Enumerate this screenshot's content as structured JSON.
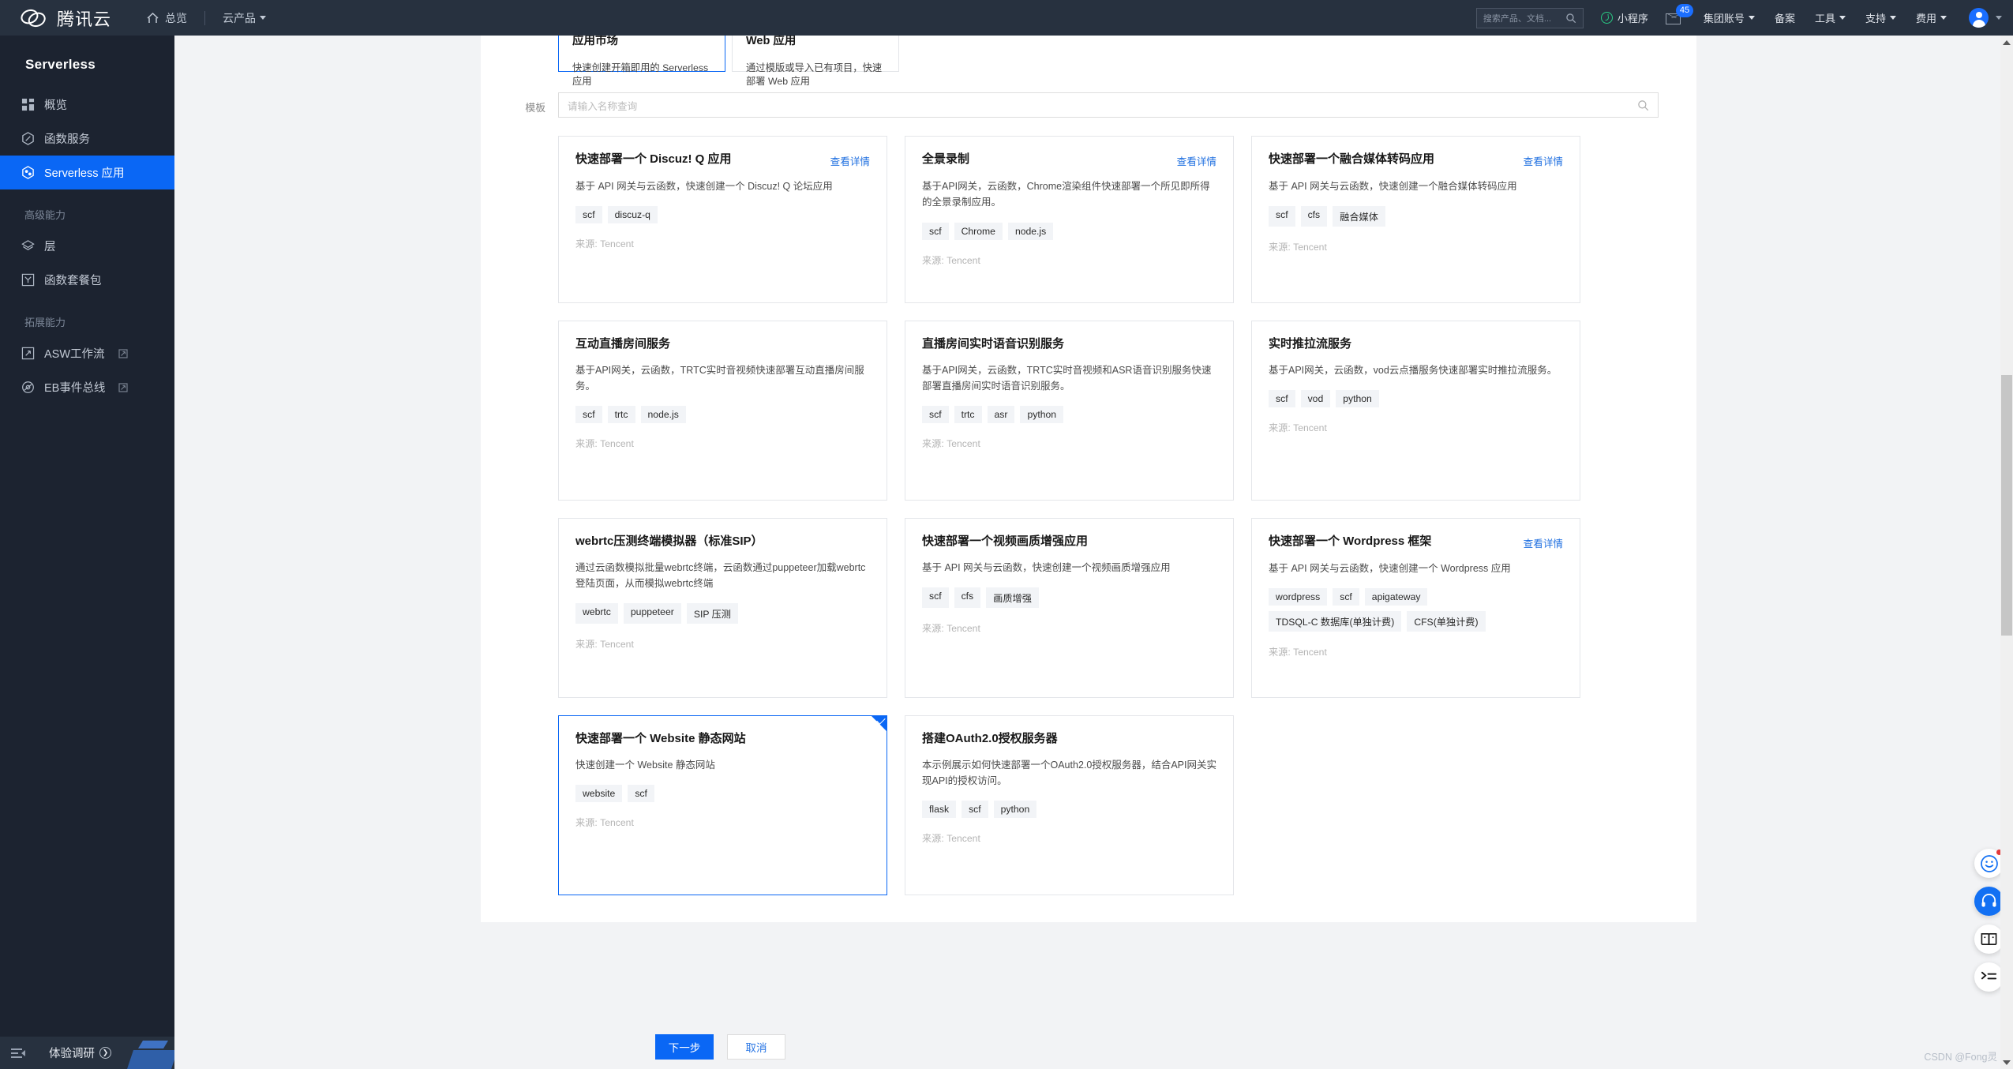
{
  "topbar": {
    "brand": "腾讯云",
    "home": "总览",
    "products": "云产品",
    "search_placeholder": "搜索产品、文档...",
    "mini_app": "小程序",
    "mail_badge": "45",
    "items": [
      {
        "label": "集团账号",
        "caret": true
      },
      {
        "label": "备案",
        "caret": false
      },
      {
        "label": "工具",
        "caret": true
      },
      {
        "label": "支持",
        "caret": true
      },
      {
        "label": "费用",
        "caret": true
      }
    ]
  },
  "sidebar": {
    "title": "Serverless",
    "items": [
      {
        "label": "概览",
        "icon": "grid-icon",
        "active": false,
        "external": false
      },
      {
        "label": "函数服务",
        "icon": "function-icon",
        "active": false,
        "external": false
      },
      {
        "label": "Serverless 应用",
        "icon": "app-icon",
        "active": true,
        "external": false
      }
    ],
    "group_advanced": "高级能力",
    "advanced_items": [
      {
        "label": "层",
        "icon": "layers-icon",
        "external": false
      },
      {
        "label": "函数套餐包",
        "icon": "package-icon",
        "external": false
      }
    ],
    "group_extend": "拓展能力",
    "extend_items": [
      {
        "label": "ASW工作流",
        "icon": "workflow-icon",
        "external": true
      },
      {
        "label": "EB事件总线",
        "icon": "eventbus-icon",
        "external": true
      }
    ],
    "survey": "体验调研"
  },
  "type_cards": [
    {
      "title": "应用市场",
      "desc": "快速创建开箱即用的 Serverless 应用",
      "selected": true
    },
    {
      "title": "Web 应用",
      "desc": "通过模版或导入已有项目，快速部署 Web 应用",
      "selected": false
    }
  ],
  "template_section": {
    "label": "模板",
    "search_placeholder": "请输入名称查询",
    "detail_link": "查看详情",
    "source_prefix": "来源: ",
    "cards": [
      {
        "title": "快速部署一个 Discuz! Q 应用",
        "desc": "基于 API 网关与云函数，快速创建一个 Discuz! Q 论坛应用",
        "tags": [
          "scf",
          "discuz-q"
        ],
        "source": "Tencent",
        "has_detail": true,
        "selected": false
      },
      {
        "title": "全景录制",
        "desc": "基于API网关，云函数，Chrome渲染组件快速部署一个所见即所得的全景录制应用。",
        "tags": [
          "scf",
          "Chrome",
          "node.js"
        ],
        "source": "Tencent",
        "has_detail": true,
        "selected": false
      },
      {
        "title": "快速部署一个融合媒体转码应用",
        "desc": "基于 API 网关与云函数，快速创建一个融合媒体转码应用",
        "tags": [
          "scf",
          "cfs",
          "融合媒体"
        ],
        "source": "Tencent",
        "has_detail": true,
        "selected": false
      },
      {
        "title": "互动直播房间服务",
        "desc": "基于API网关，云函数，TRTC实时音视频快速部署互动直播房间服务。",
        "tags": [
          "scf",
          "trtc",
          "node.js"
        ],
        "source": "Tencent",
        "has_detail": false,
        "selected": false
      },
      {
        "title": "直播房间实时语音识别服务",
        "desc": "基于API网关，云函数，TRTC实时音视频和ASR语音识别服务快速部署直播房间实时语音识别服务。",
        "tags": [
          "scf",
          "trtc",
          "asr",
          "python"
        ],
        "source": "Tencent",
        "has_detail": false,
        "selected": false
      },
      {
        "title": "实时推拉流服务",
        "desc": "基于API网关，云函数，vod云点播服务快速部署实时推拉流服务。",
        "tags": [
          "scf",
          "vod",
          "python"
        ],
        "source": "Tencent",
        "has_detail": false,
        "selected": false
      },
      {
        "title": "webrtc压测终端模拟器（标准SIP）",
        "desc": "通过云函数模拟批量webrtc终端，云函数通过puppeteer加载webrtc登陆页面，从而模拟webrtc终端",
        "tags": [
          "webrtc",
          "puppeteer",
          "SIP 压测"
        ],
        "source": "Tencent",
        "has_detail": false,
        "selected": false
      },
      {
        "title": "快速部署一个视频画质增强应用",
        "desc": "基于 API 网关与云函数，快速创建一个视频画质增强应用",
        "tags": [
          "scf",
          "cfs",
          "画质增强"
        ],
        "source": "Tencent",
        "has_detail": false,
        "selected": false
      },
      {
        "title": "快速部署一个 Wordpress 框架",
        "desc": "基于 API 网关与云函数，快速创建一个 Wordpress 应用",
        "tags": [
          "wordpress",
          "scf",
          "apigateway",
          "TDSQL-C 数据库(单独计费)",
          "CFS(单独计费)"
        ],
        "source": "Tencent",
        "has_detail": true,
        "selected": false
      },
      {
        "title": "快速部署一个 Website 静态网站",
        "desc": "快速创建一个 Website 静态网站",
        "tags": [
          "website",
          "scf"
        ],
        "source": "Tencent",
        "has_detail": false,
        "selected": true
      },
      {
        "title": "搭建OAuth2.0授权服务器",
        "desc": "本示例展示如何快速部署一个OAuth2.0授权服务器，结合API网关实现API的授权访问。",
        "tags": [
          "flask",
          "scf",
          "python"
        ],
        "source": "Tencent",
        "has_detail": false,
        "selected": false
      }
    ]
  },
  "footer": {
    "next": "下一步",
    "cancel": "取消"
  },
  "float_buttons": [
    {
      "icon": "smiley-icon",
      "style": "white",
      "dot": true
    },
    {
      "icon": "headset-icon",
      "style": "blue",
      "dot": false
    },
    {
      "icon": "book-icon",
      "style": "white",
      "dot": false
    },
    {
      "icon": "console-icon",
      "style": "white",
      "dot": false
    }
  ],
  "watermark": "CSDN @Fong灵",
  "colors": {
    "accent": "#0a67f5",
    "topbar_bg": "#27313f",
    "sidebar_bg": "#1c2330",
    "page_bg": "#f2f3f5"
  }
}
